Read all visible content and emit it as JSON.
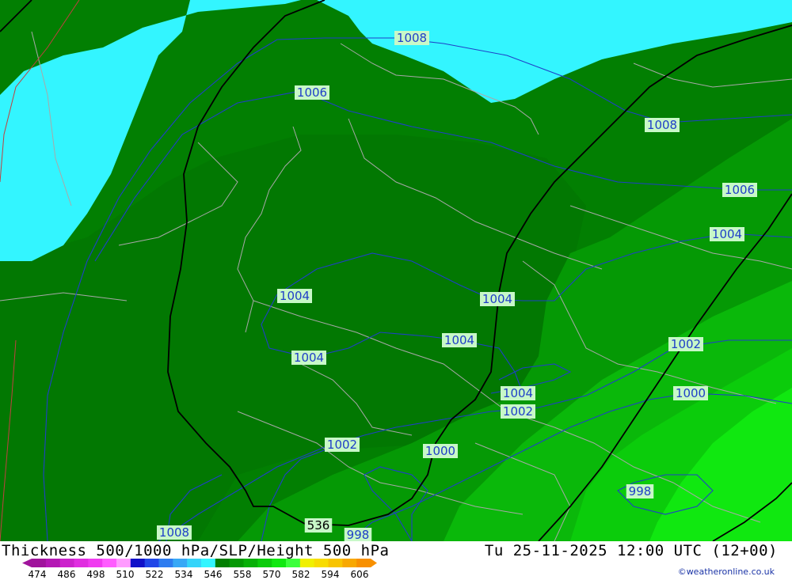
{
  "map": {
    "fill_colors": {
      "cyan": "#33f5ff",
      "dark_green": "#027f02",
      "mid_dark_green": "#059905",
      "mid_green": "#08b008",
      "light_green": "#0bcc0b",
      "bright_green": "#10e810",
      "isobar": "#1f3fc8",
      "thickness_line": "#000000",
      "border_line": "#a8a8a8",
      "label_bg": "#c8f8c8"
    },
    "isobar_labels": [
      {
        "text": "1008"
      },
      {
        "text": "1006"
      },
      {
        "text": "1008"
      },
      {
        "text": "1006"
      },
      {
        "text": "1004"
      },
      {
        "text": "1004"
      },
      {
        "text": "1004"
      },
      {
        "text": "1004"
      },
      {
        "text": "1004"
      },
      {
        "text": "1004"
      },
      {
        "text": "1002"
      },
      {
        "text": "1000"
      },
      {
        "text": "1002"
      },
      {
        "text": "1002"
      },
      {
        "text": "1000"
      },
      {
        "text": "998"
      },
      {
        "text": "1008"
      },
      {
        "text": "998"
      }
    ],
    "thickness_labels": [
      {
        "text": "536"
      }
    ]
  },
  "footer": {
    "title": "Thickness 500/1000 hPa/SLP/Height 500 hPa",
    "datetime": "Tu 25-11-2025 12:00 UTC (12+00)",
    "credit": "©weatheronline.co.uk",
    "scale_values": [
      "474",
      "486",
      "498",
      "510",
      "522",
      "534",
      "546",
      "558",
      "570",
      "582",
      "594",
      "606"
    ],
    "scale_colors": [
      "#a0149c",
      "#b418b4",
      "#cc22cc",
      "#e02ee0",
      "#f03cf0",
      "#ff5cff",
      "#ff9cff",
      "#1010c8",
      "#2046e8",
      "#2e7cf0",
      "#38a8f6",
      "#36d4fa",
      "#33f5ff",
      "#027f02",
      "#059905",
      "#08b008",
      "#0bcc0b",
      "#10e810",
      "#3cff3c",
      "#f0f000",
      "#f8dc00",
      "#f8c400",
      "#f8a800",
      "#f89000"
    ]
  }
}
